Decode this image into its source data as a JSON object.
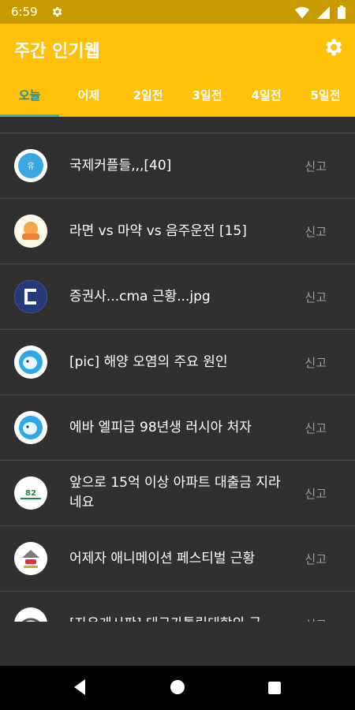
{
  "status": {
    "time": "6:59"
  },
  "app": {
    "title": "주간 인기웹"
  },
  "tabs": [
    "오늘",
    "어제",
    "2일전",
    "3일전",
    "4일전",
    "5일전"
  ],
  "report_label": "신고",
  "posts": [
    {
      "title": "국제커플들,,,[40]",
      "icon": "wooyou-logo-icon"
    },
    {
      "title": "라면 vs 마약 vs 음주운전 [15]",
      "icon": "today-humor-logo-icon"
    },
    {
      "title": "증권사...cma 근황...jpg",
      "icon": "blue-c-logo-icon"
    },
    {
      "title": "[pic] 해양 오염의 주요 원인",
      "icon": "blue-bird-logo-icon"
    },
    {
      "title": "에바 엘피급 98년생 러시아 처자",
      "icon": "blue-bird-logo-icon"
    },
    {
      "title": "앞으로 15억 이상 아파트 대출금 지라네요",
      "icon": "82cook-logo-icon"
    },
    {
      "title": "어제자 애니메이션 페스티벌 근황",
      "icon": "humor-bird-logo-icon"
    },
    {
      "title": "[자유게시판] 대구가톨릭대학의 급",
      "icon": "dome-logo-icon"
    }
  ]
}
